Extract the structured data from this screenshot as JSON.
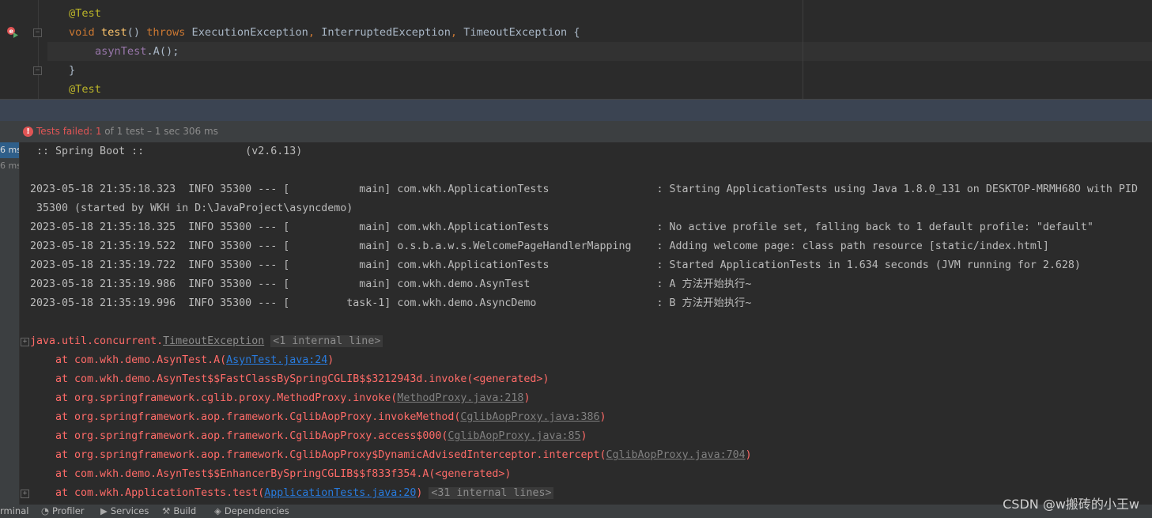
{
  "editor": {
    "lines": [
      {
        "indent": 0,
        "segments": [
          {
            "t": "@Test",
            "c": "ann"
          }
        ]
      },
      {
        "indent": 0,
        "segments": [
          {
            "t": "void ",
            "c": "kw"
          },
          {
            "t": "test",
            "c": "fn"
          },
          {
            "t": "() ",
            "c": ""
          },
          {
            "t": "throws ",
            "c": "kw"
          },
          {
            "t": "ExecutionException",
            "c": ""
          },
          {
            "t": ", ",
            "c": "kw"
          },
          {
            "t": "InterruptedException",
            "c": ""
          },
          {
            "t": ", ",
            "c": "kw"
          },
          {
            "t": "TimeoutException {",
            "c": ""
          }
        ]
      },
      {
        "indent": 1,
        "segments": [
          {
            "t": "asynTest",
            "c": "fld"
          },
          {
            "t": ".A();",
            "c": ""
          }
        ]
      },
      {
        "indent": 0,
        "segments": [
          {
            "t": "}",
            "c": ""
          }
        ]
      },
      {
        "indent": 0,
        "segments": [
          {
            "t": "@Test",
            "c": "ann"
          }
        ]
      }
    ]
  },
  "test_status": {
    "label": "Tests failed: ",
    "failed": "1",
    "rest": " of 1 test – 1 sec 306 ms",
    "error_color": "#e05555"
  },
  "test_tree": {
    "durations": [
      "6 ms",
      "6 ms"
    ]
  },
  "console": {
    "lines": [
      {
        "fold": false,
        "segments": [
          {
            "t": " :: Spring Boot ::                (v2.6.13)",
            "c": ""
          }
        ]
      },
      {
        "fold": false,
        "segments": []
      },
      {
        "fold": false,
        "segments": [
          {
            "t": "2023-05-18 21:35:18.323  INFO 35300 --- [           main] com.wkh.ApplicationTests                 : Starting ApplicationTests using Java 1.8.0_131 on DESKTOP-MRMH68O with PID",
            "c": ""
          }
        ]
      },
      {
        "fold": false,
        "segments": [
          {
            "t": " 35300 (started by WKH in D:\\JavaProject\\asyncdemo)",
            "c": ""
          }
        ]
      },
      {
        "fold": false,
        "segments": [
          {
            "t": "2023-05-18 21:35:18.325  INFO 35300 --- [           main] com.wkh.ApplicationTests                 : No active profile set, falling back to 1 default profile: \"default\"",
            "c": ""
          }
        ]
      },
      {
        "fold": false,
        "segments": [
          {
            "t": "2023-05-18 21:35:19.522  INFO 35300 --- [           main] o.s.b.a.w.s.WelcomePageHandlerMapping    : Adding welcome page: class path resource [static/index.html]",
            "c": ""
          }
        ]
      },
      {
        "fold": false,
        "segments": [
          {
            "t": "2023-05-18 21:35:19.722  INFO 35300 --- [           main] com.wkh.ApplicationTests                 : Started ApplicationTests in 1.634 seconds (JVM running for 2.628)",
            "c": ""
          }
        ]
      },
      {
        "fold": false,
        "segments": [
          {
            "t": "2023-05-18 21:35:19.986  INFO 35300 --- [           main] com.wkh.demo.AsynTest                    : A 方法开始执行~",
            "c": ""
          }
        ]
      },
      {
        "fold": false,
        "segments": [
          {
            "t": "2023-05-18 21:35:19.996  INFO 35300 --- [         task-1] com.wkh.demo.AsyncDemo                   : B 方法开始执行~",
            "c": ""
          }
        ]
      },
      {
        "fold": false,
        "segments": []
      },
      {
        "fold": true,
        "segments": [
          {
            "t": "java.util.concurrent.",
            "c": "err"
          },
          {
            "t": "TimeoutException",
            "c": "cls"
          },
          {
            "t": " ",
            "c": ""
          },
          {
            "t": "<1 internal line>",
            "c": "fold"
          }
        ]
      },
      {
        "fold": false,
        "segments": [
          {
            "t": "    at com.wkh.demo.AsynTest.A(",
            "c": "err"
          },
          {
            "t": "AsynTest.java:24",
            "c": "link"
          },
          {
            "t": ")",
            "c": "err"
          }
        ]
      },
      {
        "fold": false,
        "segments": [
          {
            "t": "    at com.wkh.demo.AsynTest$$FastClassBySpringCGLIB$$3212943d.invoke(<generated>)",
            "c": "err"
          }
        ]
      },
      {
        "fold": false,
        "segments": [
          {
            "t": "    at org.springframework.cglib.proxy.MethodProxy.invoke(",
            "c": "err"
          },
          {
            "t": "MethodProxy.java:218",
            "c": "link-gray"
          },
          {
            "t": ")",
            "c": "err"
          }
        ]
      },
      {
        "fold": false,
        "segments": [
          {
            "t": "    at org.springframework.aop.framework.CglibAopProxy.invokeMethod(",
            "c": "err"
          },
          {
            "t": "CglibAopProxy.java:386",
            "c": "link-gray"
          },
          {
            "t": ")",
            "c": "err"
          }
        ]
      },
      {
        "fold": false,
        "segments": [
          {
            "t": "    at org.springframework.aop.framework.CglibAopProxy.access$000(",
            "c": "err"
          },
          {
            "t": "CglibAopProxy.java:85",
            "c": "link-gray"
          },
          {
            "t": ")",
            "c": "err"
          }
        ]
      },
      {
        "fold": false,
        "segments": [
          {
            "t": "    at org.springframework.aop.framework.CglibAopProxy$DynamicAdvisedInterceptor.intercept(",
            "c": "err"
          },
          {
            "t": "CglibAopProxy.java:704",
            "c": "link-gray"
          },
          {
            "t": ")",
            "c": "err"
          }
        ]
      },
      {
        "fold": false,
        "segments": [
          {
            "t": "    at com.wkh.demo.AsynTest$$EnhancerBySpringCGLIB$$f833f354.A(<generated>)",
            "c": "err"
          }
        ]
      },
      {
        "fold": true,
        "segments": [
          {
            "t": "    at com.wkh.ApplicationTests.test(",
            "c": "err"
          },
          {
            "t": "ApplicationTests.java:20",
            "c": "link"
          },
          {
            "t": ") ",
            "c": "err"
          },
          {
            "t": "<31 internal lines>",
            "c": "fold"
          }
        ]
      }
    ]
  },
  "toolbar": {
    "items": [
      {
        "label": "rminal",
        "icon": "terminal-icon",
        "glyph": ""
      },
      {
        "label": "Profiler",
        "icon": "profiler-icon",
        "glyph": "◔"
      },
      {
        "label": "Services",
        "icon": "services-icon",
        "glyph": "▶"
      },
      {
        "label": "Build",
        "icon": "hammer-icon",
        "glyph": "⚒"
      },
      {
        "label": "Dependencies",
        "icon": "dependencies-icon",
        "glyph": "◈"
      }
    ]
  },
  "watermark": "CSDN @w搬砖的小王w"
}
